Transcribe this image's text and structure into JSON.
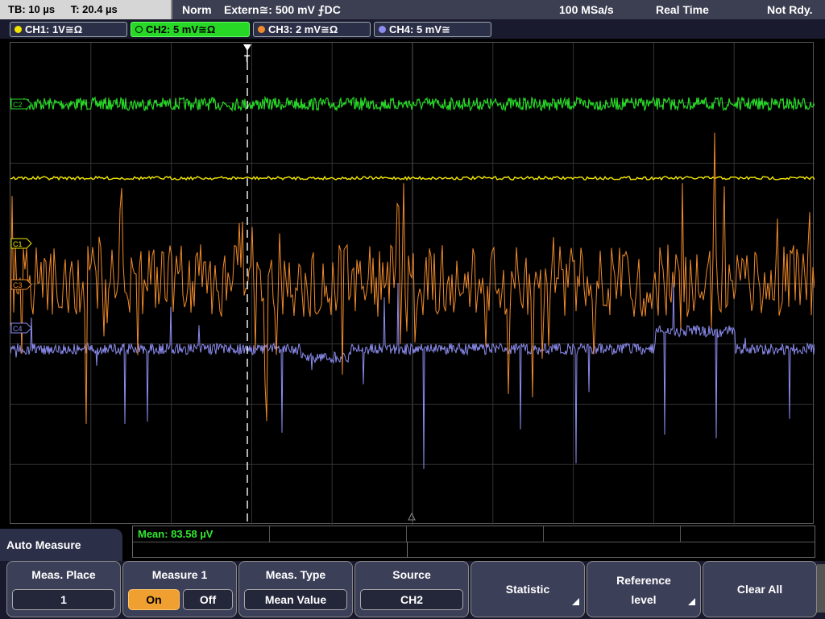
{
  "status": {
    "timebase": "TB: 10 µs",
    "trigger_time": "T: 20.4 µs",
    "mode": "Norm",
    "trigger_source": "Extern≅: 500 mV ⨍DC",
    "sample_rate": "100 MSa/s",
    "acq_mode": "Real Time",
    "ready_state": "Not Rdy."
  },
  "channels": [
    {
      "label": "CH1: 1V≅Ω",
      "color": "#f2e600",
      "active": false
    },
    {
      "label": "CH2: 5 mV≅Ω",
      "color": "#27d827",
      "active": true
    },
    {
      "label": "CH3: 2 mV≅Ω",
      "color": "#f08a2a",
      "active": false
    },
    {
      "label": "CH4: 5 mV≅",
      "color": "#8c8cf0",
      "active": false
    }
  ],
  "markers": {
    "ch1": "C1",
    "ch2": "C2",
    "ch3": "C3",
    "ch4": "C4",
    "trigger": "T"
  },
  "measurement": {
    "result": "Mean: 83.58 µV"
  },
  "menu": {
    "title": "Auto Measure",
    "meas_place": {
      "label": "Meas. Place",
      "value": "1"
    },
    "measure1": {
      "label": "Measure 1",
      "on": "On",
      "off": "Off",
      "state": "On"
    },
    "meas_type": {
      "label": "Meas. Type",
      "value": "Mean Value"
    },
    "source": {
      "label": "Source",
      "value": "CH2"
    },
    "statistic": {
      "label": "Statistic"
    },
    "reference": {
      "label1": "Reference",
      "label2": "level"
    },
    "clear_all": {
      "label": "Clear All"
    }
  },
  "colors": {
    "ch1": "#f2e600",
    "ch2": "#27d827",
    "ch3": "#f08a2a",
    "ch4": "#8c8cf0",
    "active_key": "#f0a030"
  }
}
